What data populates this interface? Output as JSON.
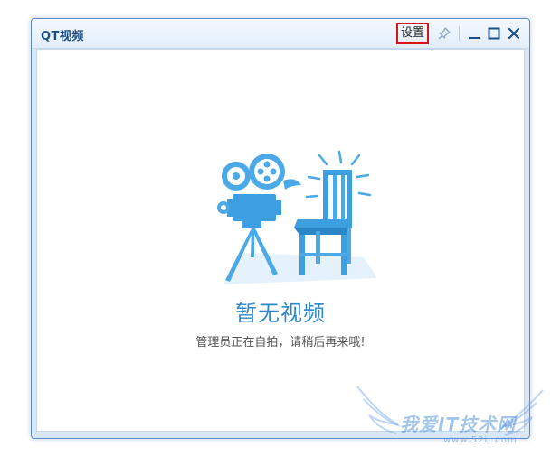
{
  "window": {
    "title": "QT视频",
    "settings_label": "设置",
    "accent_color": "#2f88c8",
    "highlight_border_color": "#d8141c"
  },
  "icons": [
    "pin-icon",
    "minimize-icon",
    "maximize-icon",
    "close-icon",
    "camera-illustration",
    "chair-illustration"
  ],
  "empty_state": {
    "title": "暂无视频",
    "subtitle": "管理员正在自拍，请稍后再来哦!"
  },
  "watermark": {
    "text": "我爱IT技术网",
    "url": "www.52ij.com"
  }
}
